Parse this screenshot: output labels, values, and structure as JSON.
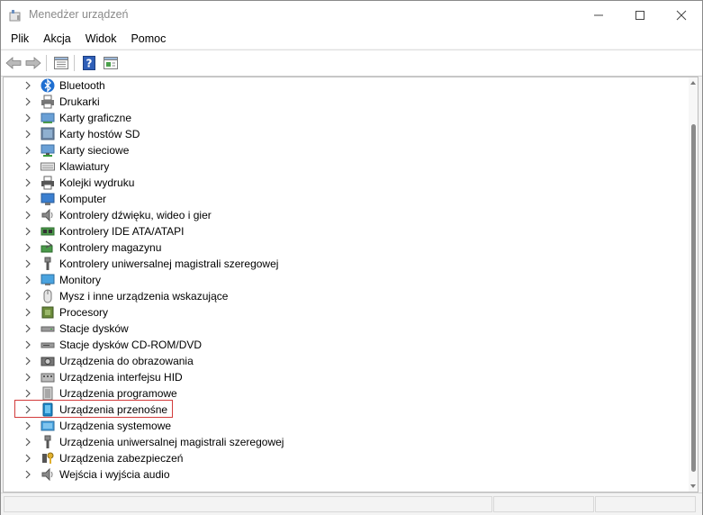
{
  "window": {
    "title": "Menedżer urządzeń"
  },
  "menu": [
    "Plik",
    "Akcja",
    "Widok",
    "Pomoc"
  ],
  "toolbar": {
    "buttons": [
      "back-arrow-icon",
      "forward-arrow-icon",
      "properties-icon",
      "help-icon",
      "update-driver-icon"
    ]
  },
  "tree": {
    "items": [
      {
        "label": "Bluetooth",
        "icon": "bluetooth-icon"
      },
      {
        "label": "Drukarki",
        "icon": "printer-icon"
      },
      {
        "label": "Karty graficzne",
        "icon": "display-adapter-icon"
      },
      {
        "label": "Karty hostów SD",
        "icon": "sd-host-icon"
      },
      {
        "label": "Karty sieciowe",
        "icon": "network-adapter-icon"
      },
      {
        "label": "Klawiatury",
        "icon": "keyboard-icon"
      },
      {
        "label": "Kolejki wydruku",
        "icon": "print-queue-icon"
      },
      {
        "label": "Komputer",
        "icon": "computer-icon"
      },
      {
        "label": "Kontrolery dźwięku, wideo i gier",
        "icon": "speaker-icon"
      },
      {
        "label": "Kontrolery IDE ATA/ATAPI",
        "icon": "ide-controller-icon"
      },
      {
        "label": "Kontrolery magazynu",
        "icon": "storage-controller-icon"
      },
      {
        "label": "Kontrolery uniwersalnej magistrali szeregowej",
        "icon": "usb-icon"
      },
      {
        "label": "Monitory",
        "icon": "monitor-icon"
      },
      {
        "label": "Mysz i inne urządzenia wskazujące",
        "icon": "mouse-icon"
      },
      {
        "label": "Procesory",
        "icon": "processor-icon"
      },
      {
        "label": "Stacje dysków",
        "icon": "disk-drive-icon"
      },
      {
        "label": "Stacje dysków CD-ROM/DVD",
        "icon": "cdrom-drive-icon"
      },
      {
        "label": "Urządzenia do obrazowania",
        "icon": "imaging-device-icon"
      },
      {
        "label": "Urządzenia interfejsu HID",
        "icon": "hid-icon"
      },
      {
        "label": "Urządzenia programowe",
        "icon": "software-device-icon"
      },
      {
        "label": "Urządzenia przenośne",
        "icon": "portable-device-icon",
        "selected": true
      },
      {
        "label": "Urządzenia systemowe",
        "icon": "system-device-icon"
      },
      {
        "label": "Urządzenia uniwersalnej magistrali szeregowej",
        "icon": "usb-device-icon"
      },
      {
        "label": "Urządzenia zabezpieczeń",
        "icon": "security-device-icon"
      },
      {
        "label": "Wejścia i wyjścia audio",
        "icon": "audio-io-icon"
      }
    ]
  },
  "colors": {
    "selection_border": "#d23b3b",
    "accent_blue": "#1f6fd1"
  }
}
